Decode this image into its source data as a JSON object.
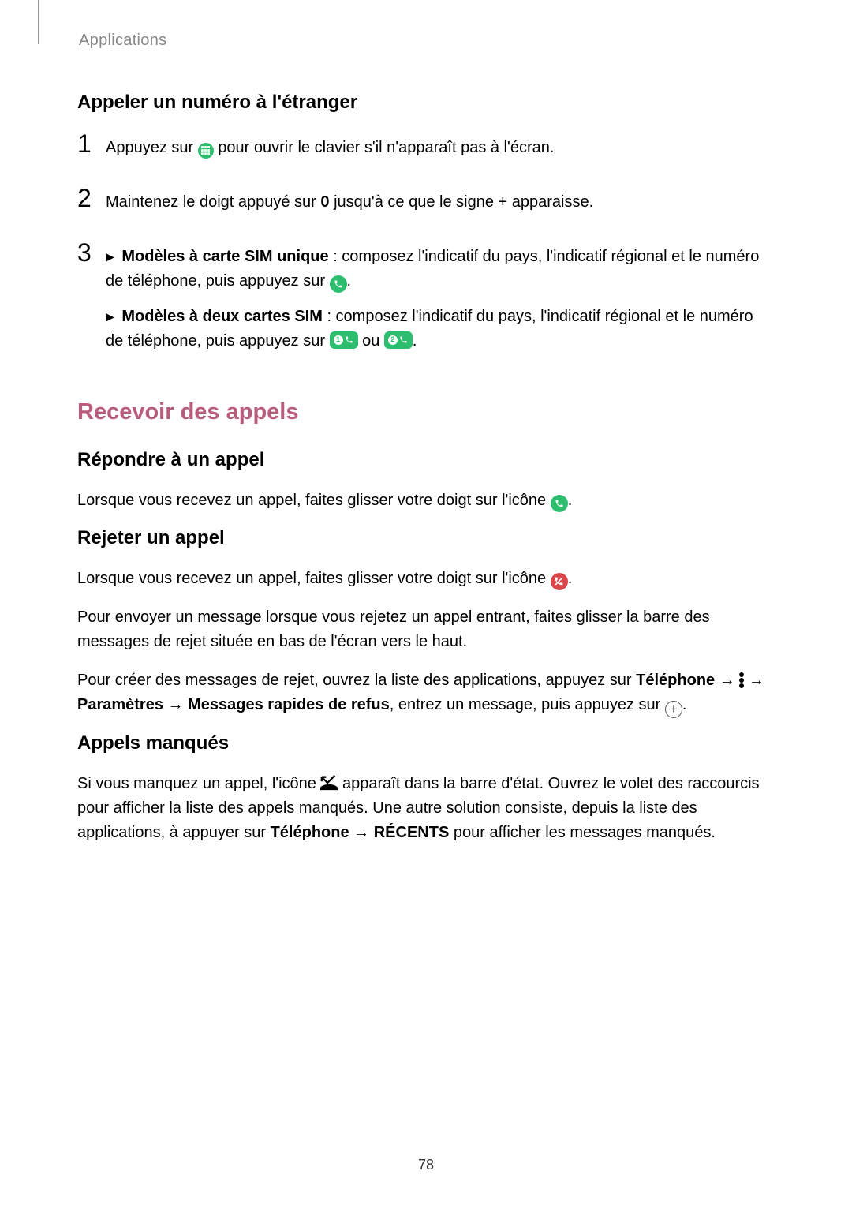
{
  "header": {
    "section": "Applications"
  },
  "s1": {
    "heading": "Appeler un numéro à l'étranger",
    "step1": {
      "num": "1",
      "a": "Appuyez sur ",
      "b": " pour ouvrir le clavier s'il n'apparaît pas à l'écran."
    },
    "step2": {
      "num": "2",
      "a": "Maintenez le doigt appuyé sur ",
      "zero": "0",
      "b": " jusqu'à ce que le signe + apparaisse."
    },
    "step3": {
      "num": "3",
      "p1_bold": "Modèles à carte SIM unique",
      "p1_a": " : composez l'indicatif du pays, l'indicatif régional et le numéro de téléphone, puis appuyez sur ",
      "p2_bold": "Modèles à deux cartes SIM",
      "p2_a": " : composez l'indicatif du pays, l'indicatif régional et le numéro de téléphone, puis appuyez sur ",
      "p2_ou": " ou "
    }
  },
  "s2": {
    "heading": "Recevoir des appels"
  },
  "s3": {
    "heading": "Répondre à un appel",
    "p": "Lorsque vous recevez un appel, faites glisser votre doigt sur l'icône "
  },
  "s4": {
    "heading": "Rejeter un appel",
    "p1": "Lorsque vous recevez un appel, faites glisser votre doigt sur l'icône ",
    "p2": "Pour envoyer un message lorsque vous rejetez un appel entrant, faites glisser la barre des messages de rejet située en bas de l'écran vers le haut.",
    "p3_a": "Pour créer des messages de rejet, ouvrez la liste des applications, appuyez sur ",
    "p3_tel": "Téléphone",
    "p3_arrow": " → ",
    "p3_b": " → ",
    "p3_params": "Paramètres",
    "p3_msg": "Messages rapides de refus",
    "p3_c": ", entrez un message, puis appuyez sur "
  },
  "s5": {
    "heading": "Appels manqués",
    "p_a": "Si vous manquez un appel, l'icône ",
    "p_b": " apparaît dans la barre d'état. Ouvrez le volet des raccourcis pour afficher la liste des appels manqués. Une autre solution consiste, depuis la liste des applications, à appuyer sur ",
    "p_tel": "Téléphone",
    "p_arrow": " → ",
    "p_rec": "RÉCENTS",
    "p_c": " pour afficher les messages manqués."
  },
  "page": "78"
}
